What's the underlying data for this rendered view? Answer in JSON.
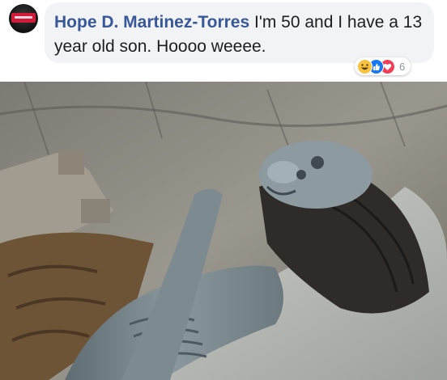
{
  "comment": {
    "author": "Hope D. Martinez-Torres",
    "text": "I'm 50 and I have a 13 year old son. Hoooo weeee.",
    "reaction_count": "6",
    "reactions": [
      "haha-icon",
      "like-icon",
      "love-icon"
    ]
  },
  "colors": {
    "author": "#385898",
    "bubble": "#f2f3f5",
    "like": "#1877f2",
    "love": "#f33e58",
    "haha": "#f7c341"
  }
}
